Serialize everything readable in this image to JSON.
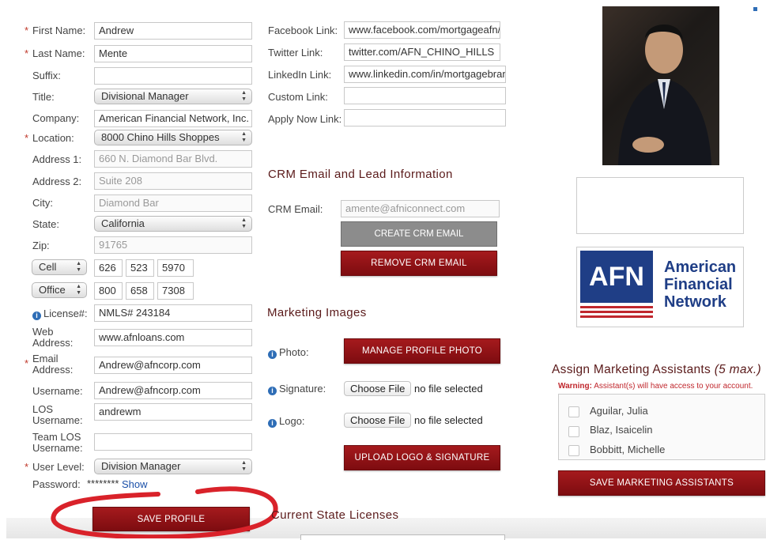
{
  "profile": {
    "first_name": {
      "label": "First Name:",
      "value": "Andrew"
    },
    "last_name": {
      "label": "Last Name:",
      "value": "Mente"
    },
    "suffix": {
      "label": "Suffix:",
      "value": ""
    },
    "title": {
      "label": "Title:",
      "value": "Divisional Manager"
    },
    "company": {
      "label": "Company:",
      "value": "American Financial Network, Inc."
    },
    "location": {
      "label": "Location:",
      "value": "8000 Chino Hills Shoppes"
    },
    "address1": {
      "label": "Address 1:",
      "value": "660 N. Diamond Bar Blvd."
    },
    "address2": {
      "label": "Address 2:",
      "value": "Suite 208"
    },
    "city": {
      "label": "City:",
      "value": "Diamond Bar"
    },
    "state": {
      "label": "State:",
      "value": "California"
    },
    "zip": {
      "label": "Zip:",
      "value": "91765"
    },
    "phone1": {
      "type": "Cell",
      "area": "626",
      "prefix": "523",
      "line": "5970"
    },
    "phone2": {
      "type": "Office",
      "area": "800",
      "prefix": "658",
      "line": "7308"
    },
    "license": {
      "label": "License#:",
      "value": "NMLS# 243184"
    },
    "web": {
      "label1": "Web",
      "label2": "Address:",
      "value": "www.afnloans.com"
    },
    "email": {
      "label1": "Email",
      "label2": "Address:",
      "value": "Andrew@afncorp.com"
    },
    "username": {
      "label": "Username:",
      "value": "Andrew@afncorp.com"
    },
    "los_username": {
      "label1": "LOS",
      "label2": "Username:",
      "value": "andrewm"
    },
    "team_los": {
      "label1": "Team LOS",
      "label2": "Username:",
      "value": ""
    },
    "user_level": {
      "label": "User Level:",
      "value": "Division Manager"
    },
    "password": {
      "label": "Password:",
      "value": "********",
      "show": "Show"
    },
    "required_mark": "*",
    "save_button": "SAVE PROFILE"
  },
  "links": {
    "facebook": {
      "label": "Facebook Link:",
      "value": "www.facebook.com/mortgageafn/"
    },
    "twitter": {
      "label": "Twitter Link:",
      "value": "twitter.com/AFN_CHINO_HILLS"
    },
    "linkedin": {
      "label": "LinkedIn Link:",
      "value": "www.linkedin.com/in/mortgagebranch"
    },
    "custom": {
      "label": "Custom Link:",
      "value": ""
    },
    "apply": {
      "label": "Apply Now Link:",
      "value": ""
    }
  },
  "crm": {
    "heading": "CRM Email and Lead Information",
    "email_label": "CRM Email:",
    "email_value": "amente@afniconnect.com",
    "create_button": "CREATE CRM EMAIL",
    "remove_button": "REMOVE CRM EMAIL"
  },
  "marketing": {
    "heading": "Marketing Images",
    "photo_label": "Photo:",
    "manage_button": "MANAGE PROFILE PHOTO",
    "signature_label": "Signature:",
    "logo_label": "Logo:",
    "choose_file": "Choose File",
    "no_file": "no file selected",
    "upload_button": "UPLOAD LOGO & SIGNATURE"
  },
  "licenses": {
    "heading": "Current State Licenses"
  },
  "logo": {
    "line1": "American",
    "line2": "Financial",
    "line3": "Network",
    "abbr": "AFN"
  },
  "assistants": {
    "heading": "Assign Marketing Assistants",
    "heading_max": "(5 max.)",
    "warning_label": "Warning:",
    "warning_text": "Assistant(s) will have access to your account.",
    "items": [
      {
        "name": "Aguilar, Julia",
        "checked": false
      },
      {
        "name": "Blaz, Isaicelin",
        "checked": false
      },
      {
        "name": "Bobbitt, Michelle",
        "checked": false
      }
    ],
    "save_button": "SAVE MARKETING ASSISTANTS"
  },
  "colors": {
    "accent_red": "#8b1217",
    "afn_blue": "#1f3e86",
    "annotation_red": "#d9222a"
  }
}
